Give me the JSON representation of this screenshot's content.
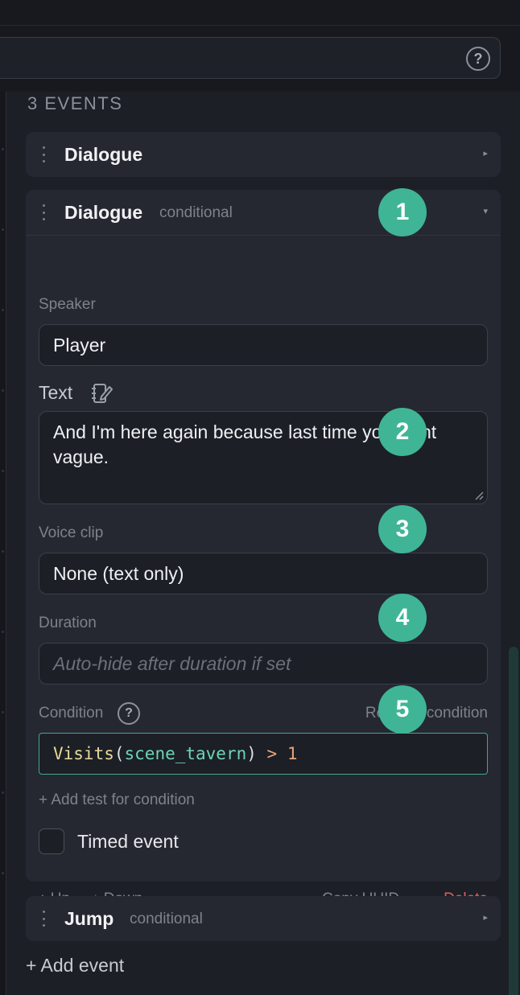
{
  "toolbar": {
    "help_glyph": "?"
  },
  "events_heading": "3 EVENTS",
  "events": [
    {
      "title": "Dialogue",
      "tag": "",
      "caret": "▸",
      "collapsed": true
    },
    {
      "title": "Dialogue",
      "tag": "conditional",
      "caret": "▾",
      "collapsed": false,
      "speaker_label": "Speaker",
      "speaker_value": "Player",
      "text_label": "Text",
      "text_value": "And I'm here again because last time you went vague.",
      "voice_label": "Voice clip",
      "voice_value": "None (text only)",
      "duration_label": "Duration",
      "duration_placeholder": "Auto-hide after duration if set",
      "condition_label": "Condition",
      "remove_condition": "Remove condition",
      "condition_tokens": {
        "fn": "Visits",
        "open": "(",
        "arg": "scene_tavern",
        "close": ")",
        "op": " > ",
        "num": "1"
      },
      "add_test": "+ Add test for condition",
      "timed_event_label": "Timed event",
      "timed_event_checked": false,
      "up": "↑ Up",
      "down": "↓ Down",
      "copy_uuid": "Copy UUID",
      "delete": "Delete"
    },
    {
      "title": "Jump",
      "tag": "conditional",
      "caret": "▸",
      "collapsed": true
    }
  ],
  "badges": [
    "1",
    "2",
    "3",
    "4",
    "5"
  ],
  "add_event": "+ Add event",
  "colors": {
    "accent": "#3fb596",
    "danger": "#e35d5b",
    "background": "#1c1f26",
    "card": "#252830"
  },
  "icons": {
    "grip": "grip-vertical-icon",
    "help": "help-circle-icon",
    "edit_text": "notebook-edit-icon"
  }
}
